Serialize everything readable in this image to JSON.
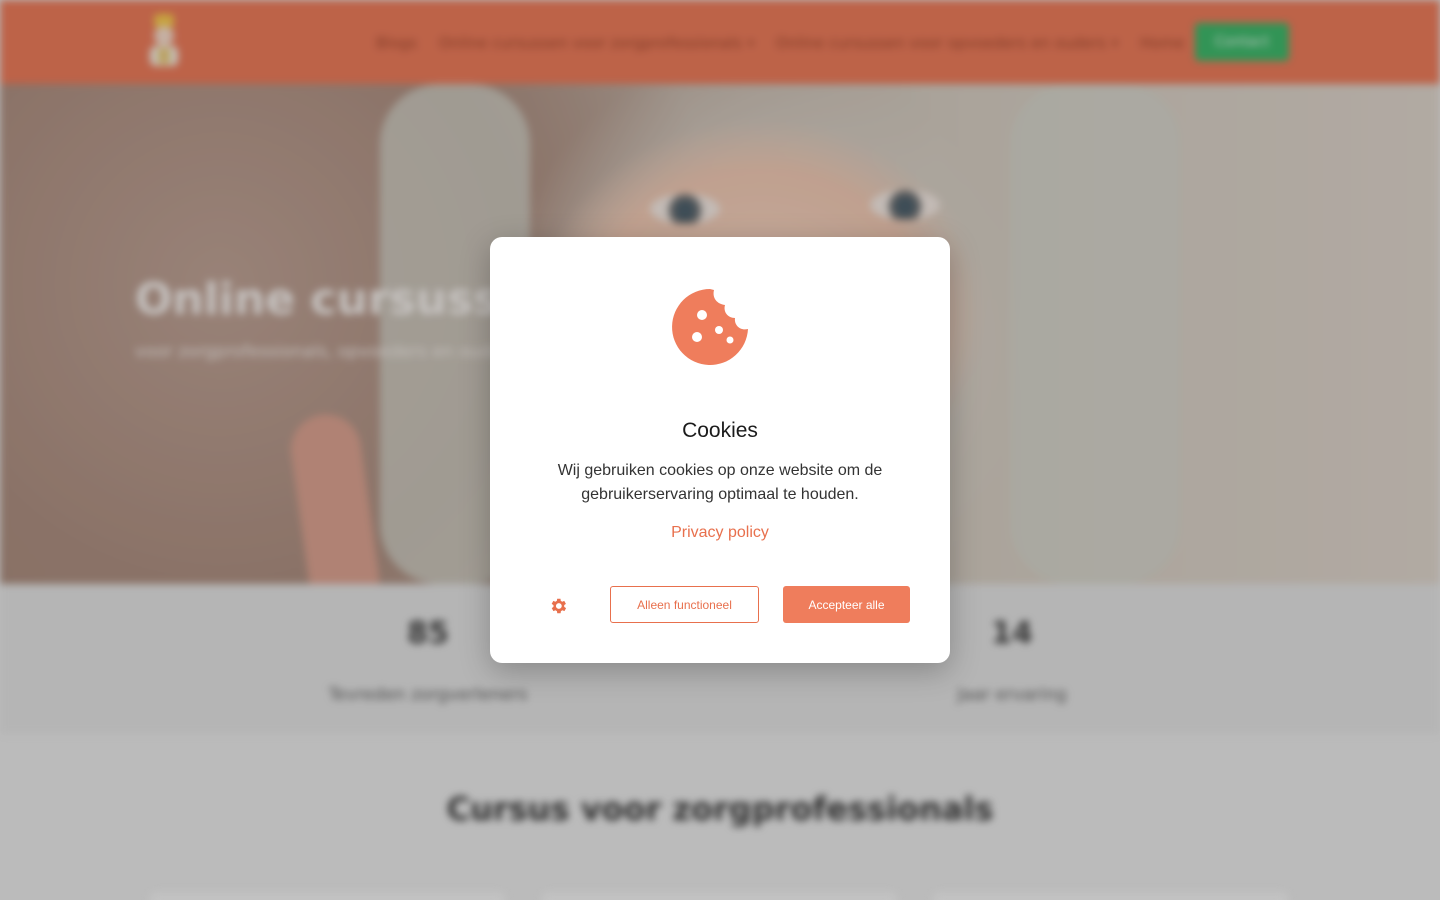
{
  "header": {
    "nav": [
      {
        "label": "Blogs",
        "has_dropdown": false
      },
      {
        "label": "Online cursussen voor zorgprofessionals",
        "has_dropdown": true
      },
      {
        "label": "Online cursussen voor opvoeders en ouders",
        "has_dropdown": true
      },
      {
        "label": "Home",
        "has_dropdown": false
      }
    ],
    "caret": "▾",
    "contact_label": "Contact",
    "colors": {
      "bar": "#e8704d",
      "contact": "#2fb25f"
    }
  },
  "hero": {
    "title": "Online cursussen",
    "subtitle": "voor zorgprofessionals, opvoeders en ouders"
  },
  "stats": [
    {
      "value": "85",
      "label": "Tevreden zorgverleners"
    },
    {
      "value": "14",
      "label": "Jaar ervaring"
    }
  ],
  "section": {
    "title": "Cursus voor zorgprofessionals"
  },
  "cookie_modal": {
    "icon": "cookie-icon",
    "title": "Cookies",
    "text": "Wij gebruiken cookies op onze website om de gebruikerservaring optimaal te houden.",
    "privacy_link": "Privacy policy",
    "settings_icon": "gear-icon",
    "functional_label": "Alleen functioneel",
    "accept_label": "Accepteer alle",
    "accent_color": "#e8704d"
  }
}
